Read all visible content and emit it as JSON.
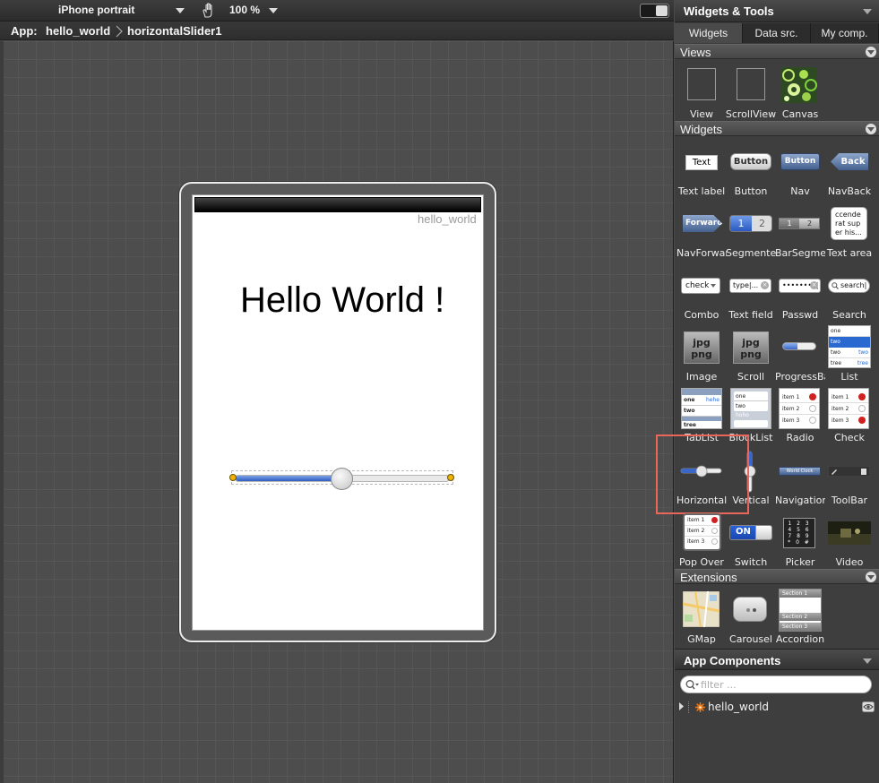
{
  "toolbar": {
    "device": "iPhone portrait",
    "zoom": "100 %",
    "icons": [
      "chevron-down-icon",
      "hand-icon",
      "toggle-icon"
    ]
  },
  "breadcrumb": {
    "prefix": "App:",
    "items": [
      "hello_world",
      "horizontalSlider1"
    ]
  },
  "canvas": {
    "app_label": "hello_world",
    "hello_text": "Hello World !",
    "slider": {
      "value": 0.5,
      "fill_color": "#3a67c8"
    }
  },
  "panel": {
    "title": "Widgets & Tools",
    "tabs": [
      "Widgets",
      "Data src.",
      "My comp."
    ],
    "active_tab": "Widgets",
    "sections": {
      "views": {
        "label": "Views",
        "items": [
          "View",
          "ScrollView",
          "Canvas"
        ]
      },
      "widgets": {
        "label": "Widgets",
        "items": [
          "Text label",
          "Button",
          "Nav",
          "NavBack",
          "NavForward",
          "Segmented",
          "BarSegmented",
          "Text area",
          "Combo",
          "Text field",
          "Passwd",
          "Search",
          "Image",
          "Scroll",
          "ProgressBar",
          "List",
          "TabList",
          "BlockList",
          "Radio",
          "Check",
          "Horizontal",
          "Vertical",
          "Navigation",
          "ToolBar",
          "Pop Over",
          "Switch",
          "Picker",
          "Video"
        ]
      },
      "extensions": {
        "label": "Extensions",
        "items": [
          "GMap",
          "Carousel",
          "Accordion"
        ]
      }
    },
    "icon_texts": {
      "text_label": "Text",
      "button": "Button",
      "nav": "Button",
      "navback": "Back",
      "navforward": "Forward",
      "segment_1": "1",
      "segment_2": "2",
      "barseg_1": "1",
      "barseg_2": "2",
      "textarea": "ccende rat sup er his...",
      "combo": "check",
      "textfield": "type|...",
      "passwd": "••••••••|",
      "search": "search|",
      "image": "jpg png",
      "scroll": "jpg png",
      "list_rows": [
        "one",
        "two",
        "two",
        "tree"
      ],
      "list_side": [
        "",
        "",
        "two",
        "tree"
      ],
      "tablist_rows": [
        "one",
        "two",
        "tree"
      ],
      "tablist_tag": "hehe",
      "blocklist_rows": [
        "one",
        "two",
        "hoho"
      ],
      "radio_rows": [
        "item 1",
        "item 2",
        "item 3"
      ],
      "check_rows": [
        "item 1",
        "item 2",
        "item 3"
      ],
      "navigation": "World Clock",
      "popover_rows": [
        "item 1",
        "item 2",
        "item 3"
      ],
      "switch": "ON",
      "picker": [
        "1 2 3",
        "4 5 6",
        "7 8 9",
        "* 0 #"
      ],
      "accordion": [
        "Section 1",
        "Section 2",
        "Section 3"
      ]
    },
    "components": {
      "title": "App Components",
      "filter_placeholder": "filter ...",
      "tree": [
        "hello_world"
      ]
    }
  }
}
